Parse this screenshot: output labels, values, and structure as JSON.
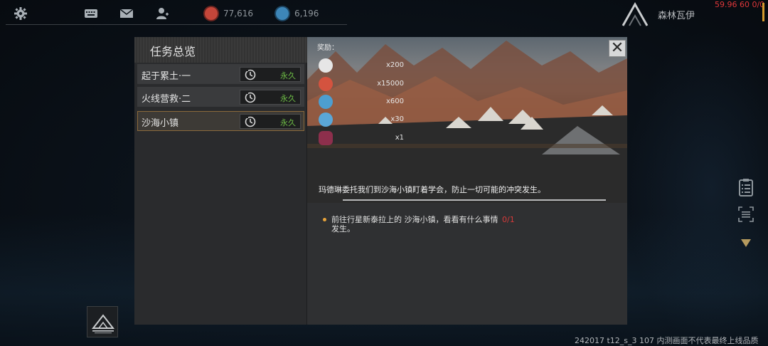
{
  "top": {
    "resources": [
      {
        "icon": "red-gem-icon",
        "value": "77,616"
      },
      {
        "icon": "blue-crystal-icon",
        "value": "6,196"
      }
    ],
    "player_name": "森林瓦伊",
    "fps": "59.96 60 0/0"
  },
  "panel": {
    "title": "任务总览",
    "tasks": [
      {
        "name": "起于累土·一",
        "duration": "永久"
      },
      {
        "name": "火线营救·二",
        "duration": "永久"
      },
      {
        "name": "沙海小镇",
        "duration": "永久"
      }
    ],
    "selected_task": 2,
    "rewards_label": "奖励：",
    "rewards": [
      {
        "icon": "helmet-token-icon",
        "qty": "x200"
      },
      {
        "icon": "red-gem-icon",
        "qty": "x15000"
      },
      {
        "icon": "blue-crystal-icon",
        "qty": "x600"
      },
      {
        "icon": "blue-orb-icon",
        "qty": "x30"
      },
      {
        "icon": "pink-flower-icon",
        "qty": "x1"
      }
    ],
    "description": "玛德琳委托我们到沙海小镇盯着学会，防止一切可能的冲突发生。",
    "objective": {
      "text": "前往行星新泰拉上的 沙海小镇，看看有什么事情发生。",
      "progress": "0/1"
    },
    "close_label": "✕"
  },
  "footer": {
    "version": "242017 t12_s_3 107  内测画面不代表最终上线品质"
  },
  "colors": {
    "accent_orange": "#e6a23a",
    "timer_green": "#6dbc45",
    "progress_red": "#d63a3a"
  }
}
